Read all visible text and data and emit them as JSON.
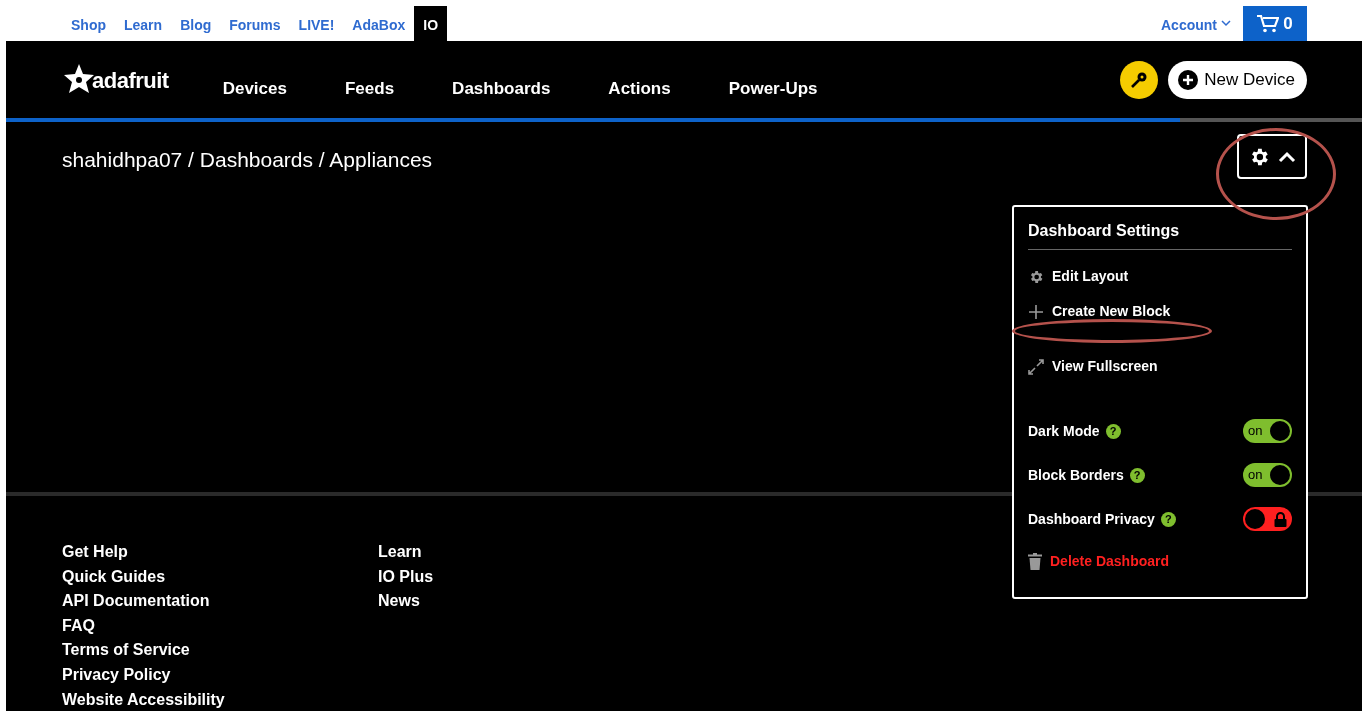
{
  "top_links": [
    {
      "label": "Shop",
      "selected": false
    },
    {
      "label": "Learn",
      "selected": false
    },
    {
      "label": "Blog",
      "selected": false
    },
    {
      "label": "Forums",
      "selected": false
    },
    {
      "label": "LIVE!",
      "selected": false
    },
    {
      "label": "AdaBox",
      "selected": false
    },
    {
      "label": "IO",
      "selected": true
    }
  ],
  "account": {
    "label": "Account"
  },
  "cart": {
    "count": "0"
  },
  "logo": {
    "text": "adafruit"
  },
  "nav": [
    "Devices",
    "Feeds",
    "Dashboards",
    "Actions",
    "Power-Ups"
  ],
  "new_device": {
    "label": "New Device"
  },
  "progress": {
    "level": 0.866
  },
  "breadcrumb": "shahidhpa07 / Dashboards / Appliances",
  "settings_menu": {
    "expanded": true,
    "title": "Dashboard Settings",
    "actions": [
      {
        "label": "Edit Layout",
        "kind": "gear"
      },
      {
        "label": "Create New Block",
        "kind": "plus"
      },
      {
        "label": "View Fullscreen",
        "kind": "expand"
      }
    ],
    "toggles": [
      {
        "label": "Dark Mode",
        "help": "?",
        "on": true,
        "state_text": "on"
      },
      {
        "label": "Block Borders",
        "help": "?",
        "on": true,
        "state_text": "on"
      },
      {
        "label": "Dashboard Privacy",
        "help": "?",
        "on": false
      }
    ],
    "danger": {
      "label": "Delete Dashboard"
    }
  },
  "footer": {
    "columns": [
      [
        "Get Help",
        "Quick Guides",
        "API Documentation",
        "FAQ",
        "Terms of Service",
        "Privacy Policy",
        "Website Accessibility"
      ],
      [
        "Learn",
        "IO Plus",
        "News"
      ]
    ]
  },
  "annotations": [
    {
      "kind": "ellipse"
    },
    {
      "kind": "ellipse"
    }
  ]
}
